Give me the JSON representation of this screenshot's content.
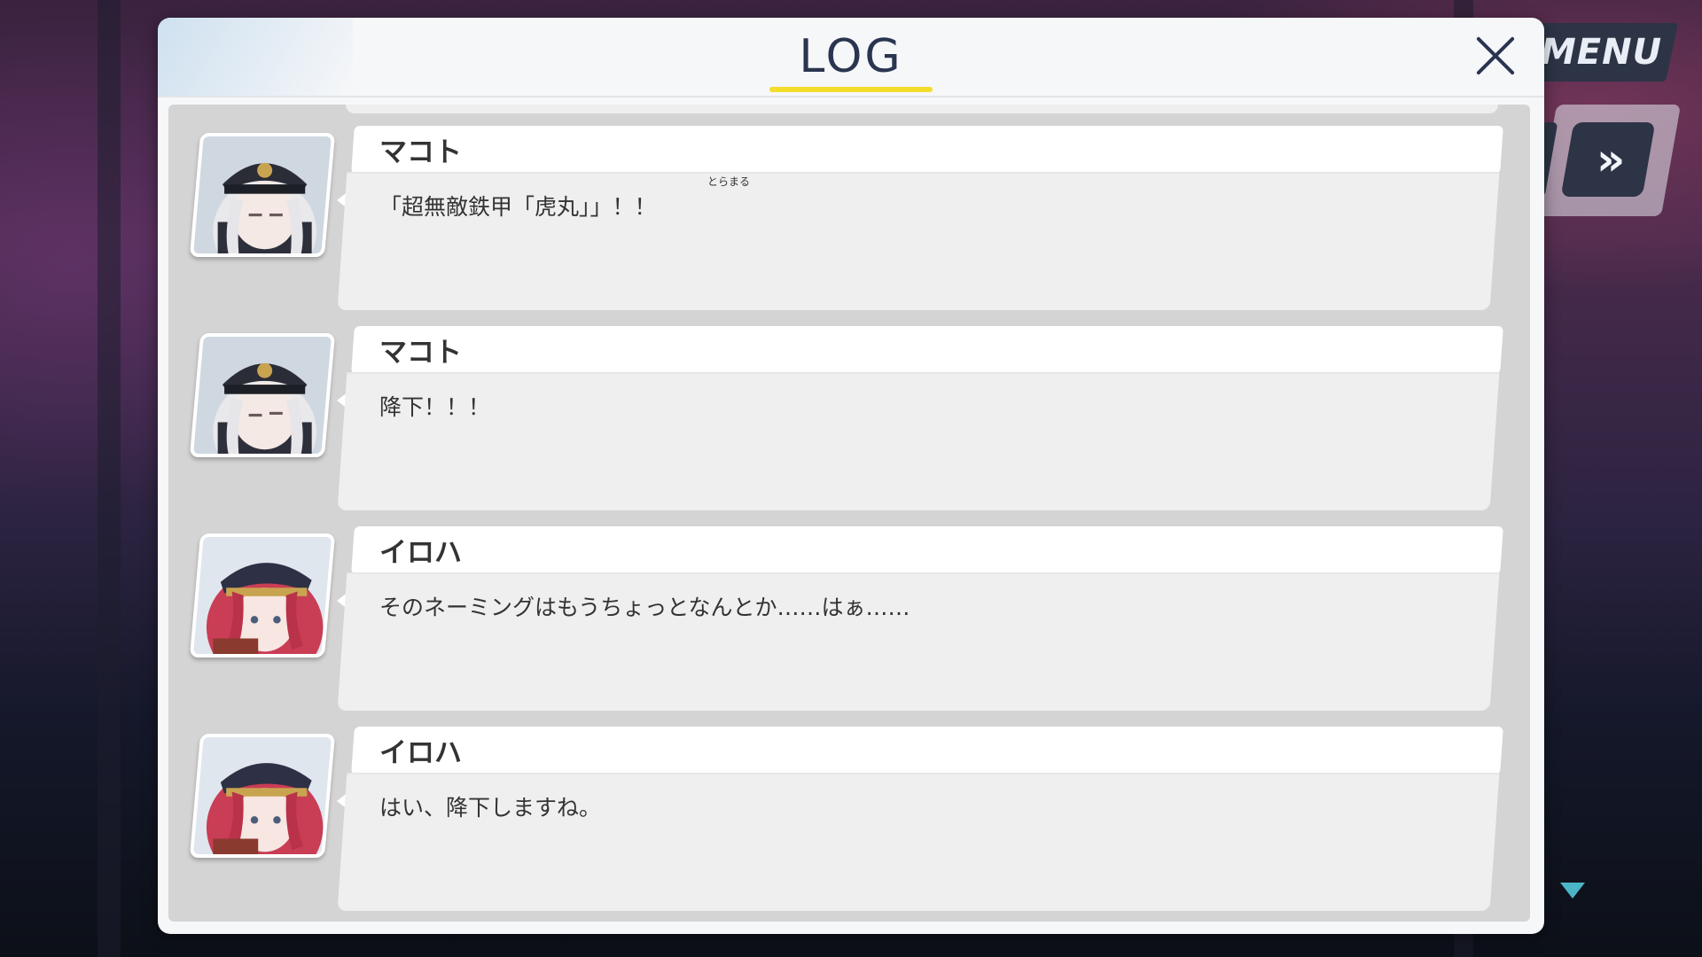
{
  "hud": {
    "menu_label": "MENU",
    "fast_forward_label": "»"
  },
  "log": {
    "title": "LOG",
    "close_label": "close",
    "entries": [
      {
        "speaker": "マコト",
        "text": "「超無敵鉄甲「虎丸」」！！",
        "ruby": "とらまる",
        "portrait": "makoto-portrait"
      },
      {
        "speaker": "マコト",
        "text": "降下！！！",
        "portrait": "makoto-portrait"
      },
      {
        "speaker": "イロハ",
        "text": "そのネーミングはもうちょっとなんとか……はぁ……",
        "portrait": "iroha-portrait"
      },
      {
        "speaker": "イロハ",
        "text": "はい、降下しますね。",
        "portrait": "iroha-portrait"
      }
    ]
  },
  "colors": {
    "accent_yellow": "#f4dc2a",
    "title_navy": "#2a3550",
    "scroll_arrow": "#4bb5c6"
  }
}
